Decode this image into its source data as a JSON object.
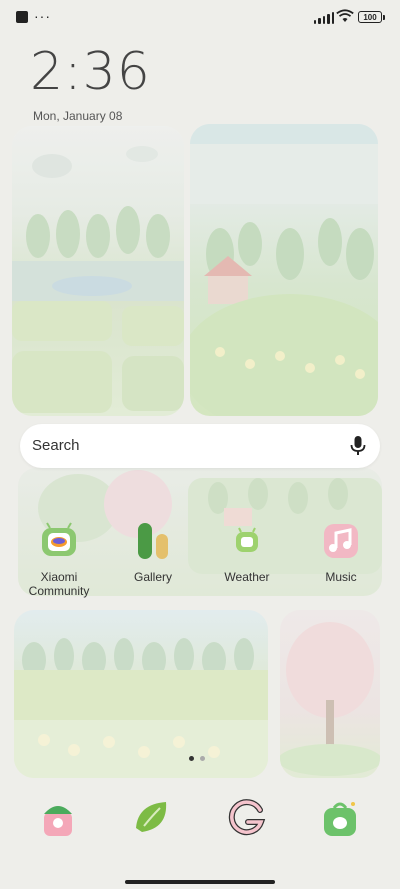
{
  "status_bar": {
    "battery": "100"
  },
  "clock": {
    "time": "2:36",
    "date": "Mon, January 08"
  },
  "search": {
    "placeholder": "Search"
  },
  "apps": [
    {
      "label": "Xiaomi\nCommunity",
      "icon": "xiaomi-community-icon"
    },
    {
      "label": "Gallery",
      "icon": "gallery-icon"
    },
    {
      "label": "Weather",
      "icon": "weather-icon"
    },
    {
      "label": "Music",
      "icon": "music-icon"
    }
  ],
  "dock": [
    {
      "icon": "phone-icon"
    },
    {
      "icon": "messages-icon"
    },
    {
      "icon": "google-icon"
    },
    {
      "icon": "app-store-icon"
    }
  ],
  "page_indicator": {
    "current": 1,
    "total": 2
  },
  "colors": {
    "wallpaper": "#eeeeea",
    "accent_green": "#8cc870",
    "accent_pink": "#f2b8c4"
  }
}
